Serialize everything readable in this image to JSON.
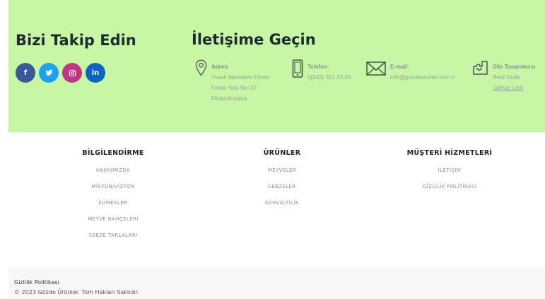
{
  "follow": {
    "title": "Bizi Takip Edin",
    "socials": [
      {
        "icon": "facebook-icon",
        "glyph": "f",
        "color": "#3b5998"
      },
      {
        "icon": "twitter-icon",
        "glyph": "•",
        "color": "#1da1f2"
      },
      {
        "icon": "instagram-icon",
        "glyph": "◎",
        "color": "#c13584"
      },
      {
        "icon": "linkedin-icon",
        "glyph": "in",
        "color": "#0a66c2"
      }
    ]
  },
  "contact": {
    "title": "İletişime Geçin",
    "address": {
      "label": "Adres:",
      "line1": "Yuvalı Mahallesi Elmalı",
      "line2": "Finike Yolu No: 37",
      "line3": "Finike/Antalya"
    },
    "phone": {
      "label": "Telefon:",
      "value": "0(242) 321 23 30"
    },
    "email": {
      "label": "E-mail:",
      "value": "info@gozdeurunler.com.tr"
    },
    "designer": {
      "label": "Site Tasarımcısı",
      "name": "Betül Erdik",
      "link": "GitHub Linki"
    }
  },
  "columns": [
    {
      "heading": "BİLGİLENDİRME",
      "items": [
        "HAKKIMIZDA",
        "MİSYON/VİZYON",
        "KÜMESLER",
        "MEYVE BAHÇELERİ",
        "SEBZE TARLALARI"
      ]
    },
    {
      "heading": "ÜRÜNLER",
      "items": [
        "MEYVELER",
        "SEBZELER",
        "KAHVALTILIK"
      ]
    },
    {
      "heading": "MÜŞTERİ HİZMETLERİ",
      "items": [
        "İLETİŞİM",
        "GİZLİLİK POLİTİKASI"
      ]
    }
  ],
  "footer": {
    "privacy": "Gizlilik Politikası",
    "copyright": "© 2023 Gözde Ürünler. Tüm Hakları Saklıdır."
  },
  "colors": {
    "band": "#c7f6a4",
    "heading": "#1f2a33"
  }
}
